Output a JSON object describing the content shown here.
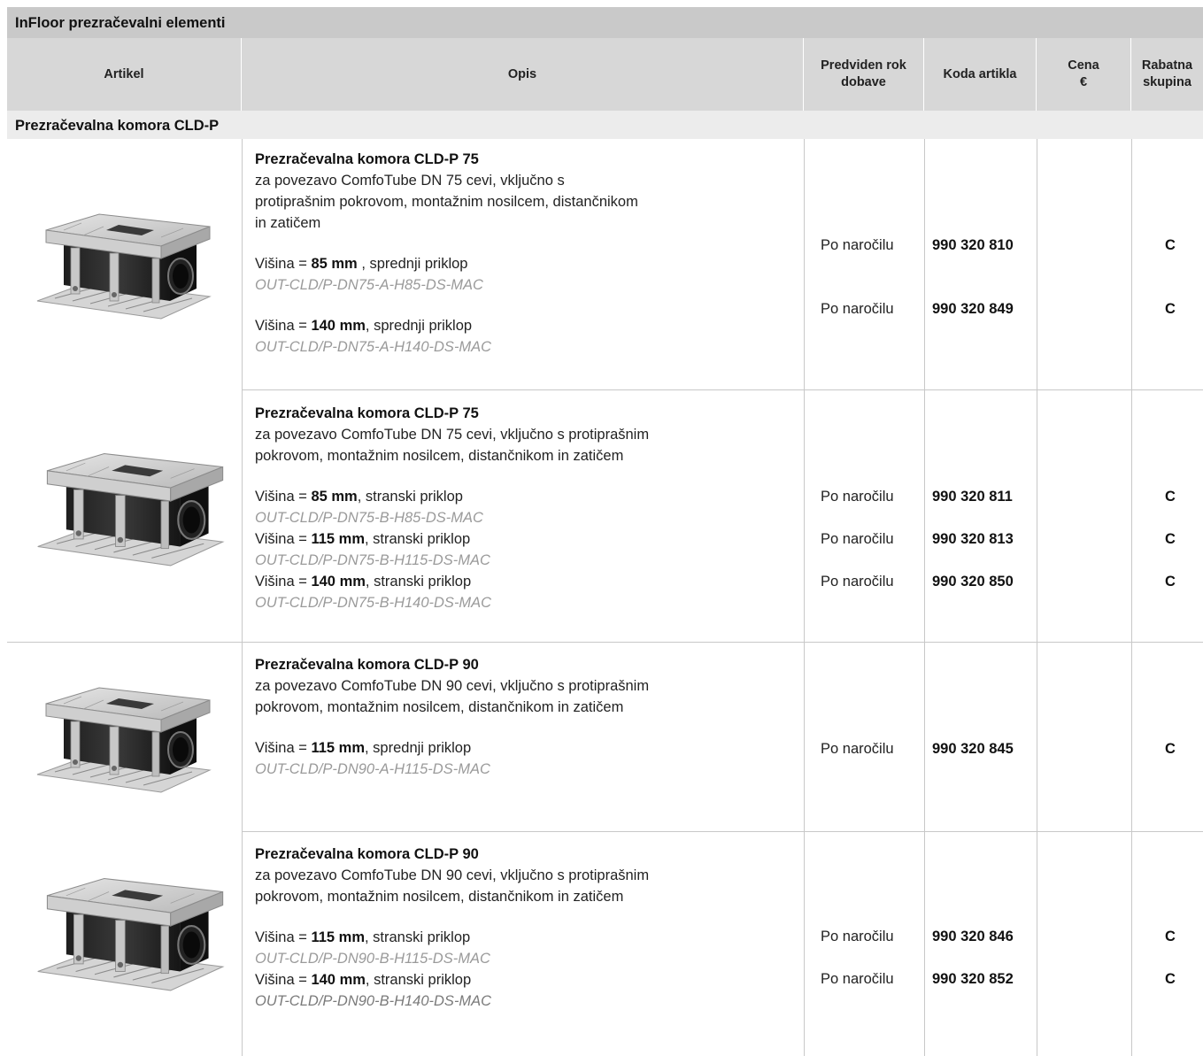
{
  "title": "InFloor prezračevalni elementi",
  "headers": {
    "artikel": "Artikel",
    "opis": "Opis",
    "rok_line1": "Predviden rok",
    "rok_line2": "dobave",
    "koda": "Koda artikla",
    "cena_line1": "Cena",
    "cena_line2": "€",
    "rabat_line1": "Rabatna",
    "rabat_line2": "skupina"
  },
  "section": "Prezračevalna komora CLD-P",
  "items": [
    {
      "title": "Prezračevalna komora CLD-P 75",
      "desc_lines": [
        "za povezavo ComfoTube DN 75 cevi, vključno s",
        "protiprašnim pokrovom, montažnim nosilcem, distančnikom",
        "in zatičem"
      ],
      "variants": [
        {
          "prefix": "Višina = ",
          "height": "85 mm",
          "suffix": " , sprednji priklop",
          "code": "OUT-CLD/P-DN75-A-H85-DS-MAC",
          "delivery": "Po naročilu",
          "article_code": "990 320 810",
          "discount": "C"
        },
        {
          "prefix": "Višina = ",
          "height": "140 mm",
          "suffix": ", sprednji priklop",
          "code": "OUT-CLD/P-DN75-A-H140-DS-MAC",
          "delivery": "Po naročilu",
          "article_code": "990 320 849",
          "discount": "C"
        }
      ]
    },
    {
      "title": "Prezračevalna komora CLD-P 75",
      "desc_lines": [
        "za povezavo ComfoTube DN 75 cevi, vključno s protiprašnim",
        "pokrovom, montažnim nosilcem, distančnikom in zatičem"
      ],
      "variants": [
        {
          "prefix": "Višina = ",
          "height": "85 mm",
          "suffix": ", stranski priklop",
          "code": "OUT-CLD/P-DN75-B-H85-DS-MAC",
          "delivery": "Po naročilu",
          "article_code": "990 320 811",
          "discount": "C"
        },
        {
          "prefix": "Višina = ",
          "height": "115 mm",
          "suffix": ", stranski priklop",
          "code": "OUT-CLD/P-DN75-B-H115-DS-MAC",
          "delivery": "Po naročilu",
          "article_code": "990 320 813",
          "discount": "C"
        },
        {
          "prefix": "Višina = ",
          "height": "140 mm",
          "suffix": ", stranski priklop",
          "code": "OUT-CLD/P-DN75-B-H140-DS-MAC",
          "delivery": "Po naročilu",
          "article_code": "990 320 850",
          "discount": "C"
        }
      ]
    },
    {
      "title": "Prezračevalna komora CLD-P 90",
      "desc_lines": [
        "za povezavo ComfoTube DN 90 cevi, vključno s protiprašnim",
        "pokrovom, montažnim nosilcem, distančnikom in zatičem"
      ],
      "variants": [
        {
          "prefix": "Višina = ",
          "height": "115 mm",
          "suffix": ", sprednji priklop",
          "code": "OUT-CLD/P-DN90-A-H115-DS-MAC",
          "delivery": "Po naročilu",
          "article_code": "990 320 845",
          "discount": "C"
        }
      ]
    },
    {
      "title": "Prezračevalna komora CLD-P 90",
      "desc_lines": [
        "za povezavo ComfoTube DN 90 cevi, vključno s protiprašnim",
        "pokrovom, montažnim nosilcem, distančnikom in zatičem"
      ],
      "variants": [
        {
          "prefix": "Višina = ",
          "height": "115 mm",
          "suffix": ", stranski priklop",
          "code": "OUT-CLD/P-DN90-B-H115-DS-MAC",
          "delivery": "Po naročilu",
          "article_code": "990 320 846",
          "discount": "C"
        },
        {
          "prefix": "Višina = ",
          "height": "140 mm",
          "suffix": ", stranski priklop",
          "code": "OUT-CLD/P-DN90-B-H140-DS-MAC",
          "delivery": "Po naročilu",
          "article_code": "990 320 852",
          "discount": "C"
        }
      ]
    }
  ]
}
